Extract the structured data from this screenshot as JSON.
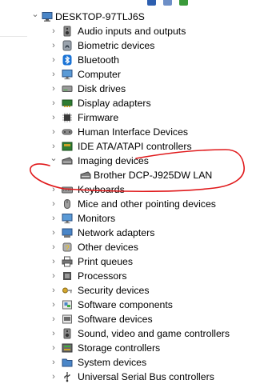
{
  "tree": {
    "root": {
      "label": "DESKTOP-97TLJ6S",
      "icon": "computer-icon",
      "expanded": true
    },
    "items": [
      {
        "label": "Audio inputs and outputs",
        "icon": "speaker-icon"
      },
      {
        "label": "Biometric devices",
        "icon": "fingerprint-icon"
      },
      {
        "label": "Bluetooth",
        "icon": "bluetooth-icon"
      },
      {
        "label": "Computer",
        "icon": "monitor-icon"
      },
      {
        "label": "Disk drives",
        "icon": "disk-drive-icon"
      },
      {
        "label": "Display adapters",
        "icon": "display-adapter-icon"
      },
      {
        "label": "Firmware",
        "icon": "chip-icon"
      },
      {
        "label": "Human Interface Devices",
        "icon": "hid-icon"
      },
      {
        "label": "IDE ATA/ATAPI controllers",
        "icon": "controller-icon"
      },
      {
        "label": "Imaging devices",
        "icon": "scanner-icon",
        "expanded": true,
        "children": [
          {
            "label": "Brother DCP-J925DW LAN",
            "icon": "scanner-icon"
          }
        ]
      },
      {
        "label": "Keyboards",
        "icon": "keyboard-icon"
      },
      {
        "label": "Mice and other pointing devices",
        "icon": "mouse-icon"
      },
      {
        "label": "Monitors",
        "icon": "monitor-icon"
      },
      {
        "label": "Network adapters",
        "icon": "network-adapter-icon"
      },
      {
        "label": "Other devices",
        "icon": "unknown-device-icon"
      },
      {
        "label": "Print queues",
        "icon": "printer-icon"
      },
      {
        "label": "Processors",
        "icon": "processor-icon"
      },
      {
        "label": "Security devices",
        "icon": "security-key-icon"
      },
      {
        "label": "Software components",
        "icon": "software-component-icon"
      },
      {
        "label": "Software devices",
        "icon": "software-device-icon"
      },
      {
        "label": "Sound, video and game controllers",
        "icon": "speaker-icon"
      },
      {
        "label": "Storage controllers",
        "icon": "storage-controller-icon"
      },
      {
        "label": "System devices",
        "icon": "system-folder-icon"
      },
      {
        "label": "Universal Serial Bus controllers",
        "icon": "usb-icon"
      }
    ]
  },
  "annotation": {
    "shape": "hand-drawn ellipse",
    "color": "#e0191b",
    "target": "Imaging devices"
  },
  "colors": {
    "toolbar_blue": "#2d5fb0",
    "toolbar_green": "#3a9a3a",
    "bluetooth_blue": "#1a73d6",
    "chevron": "#6b6b6b"
  }
}
